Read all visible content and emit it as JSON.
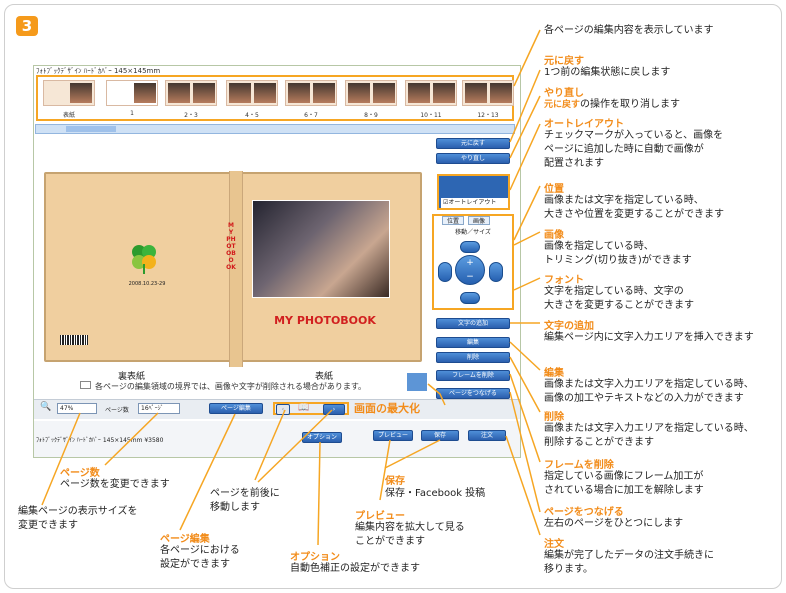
{
  "step": "3",
  "app": {
    "title": "ﾌｫﾄﾌﾞｯｸﾃﾞｻﾞｲﾝ ﾊｰﾄﾞｶﾊﾞｰ 145×145mm",
    "thumbnails": [
      "表紙",
      "1",
      "2・3",
      "4・5",
      "6・7",
      "8・9",
      "10・11",
      "12・13"
    ],
    "right_buttons": {
      "undo": "元に戻す",
      "redo": "やり直し",
      "auto_layout": "オートレイアウト",
      "tab_position": "位置",
      "tab_image": "画像",
      "move_size": "移動／サイズ",
      "add_text": "文字の追加",
      "edit": "編集",
      "delete": "削除",
      "remove_frame": "フレームを削除",
      "connect_pages": "ページをつなげる"
    },
    "book": {
      "spine": "MY PHOTOBOOK",
      "title": "MY PHOTOBOOK",
      "date": "2008.10.23-29",
      "back_label": "裏表紙",
      "front_label": "表紙",
      "note": "各ページの編集領域の境界では、画像や文字が削除される場合があります。"
    },
    "toolbar": {
      "zoom": "47%",
      "pages_label": "ページ数",
      "pages": "16ﾍﾟｰｼﾞ",
      "page_edit": "ページ編集",
      "option": "オプション",
      "preview": "プレビュー",
      "save": "保存",
      "order": "注文"
    },
    "status": "ﾌｫﾄﾌﾞｯｸﾃﾞｻﾞｲﾝ ﾊｰﾄﾞｶﾊﾞｰ 145×145mm ¥3580"
  },
  "callouts": {
    "display": "各ページの編集内容を表示しています",
    "undo_h": "元に戻す",
    "undo_d": "1つ前の編集状態に戻します",
    "redo_h": "やり直し",
    "redo_em": "元に戻す",
    "redo_d": "の操作を取り消します",
    "auto_h": "オートレイアウト",
    "auto_d1": "チェックマークが入っていると、画像を",
    "auto_d2": "ページに追加した時に自動で画像が",
    "auto_d3": "配置されます",
    "pos_h": "位置",
    "pos_d1": "画像または文字を指定している時、",
    "pos_d2": "大きさや位置を変更することができます",
    "img_h": "画像",
    "img_d1": "画像を指定している時、",
    "img_d2": "トリミング(切り抜き)ができます",
    "font_h": "フォント",
    "font_d1": "文字を指定している時、文字の",
    "font_d2": "大きさを変更することができます",
    "addtext_h": "文字の追加",
    "addtext_d": "編集ページ内に文字入力エリアを挿入できます",
    "edit_h": "編集",
    "edit_d1": "画像または文字入力エリアを指定している時、",
    "edit_d2": "画像の加工やテキストなどの入力ができます",
    "del_h": "削除",
    "del_d1": "画像または文字入力エリアを指定している時、",
    "del_d2": "削除することができます",
    "frame_h": "フレームを削除",
    "frame_d1": "指定している画像にフレーム加工が",
    "frame_d2": "されている場合に加工を解除します",
    "connect_h": "ページをつなげる",
    "connect_d": "左右のページをひとつにします",
    "order_h": "注文",
    "order_d1": "編集が完了したデータの注文手続きに",
    "order_d2": "移ります。",
    "max_h": "画面の最大化",
    "pages_h": "ページ数",
    "pages_d": "ページ数を変更できます",
    "zoom_d1": "編集ページの表示サイズを",
    "zoom_d2": "変更できます",
    "pageedit_h": "ページ編集",
    "pageedit_d1": "各ページにおける",
    "pageedit_d2": "設定ができます",
    "nav_d1": "ページを前後に",
    "nav_d2": "移動します",
    "option_h": "オプション",
    "option_d": "自動色補正の設定ができます",
    "preview_h": "プレビュー",
    "preview_d1": "編集内容を拡大して見る",
    "preview_d2": "ことができます",
    "save_h": "保存",
    "save_d": "保存・Facebook 投稿"
  }
}
